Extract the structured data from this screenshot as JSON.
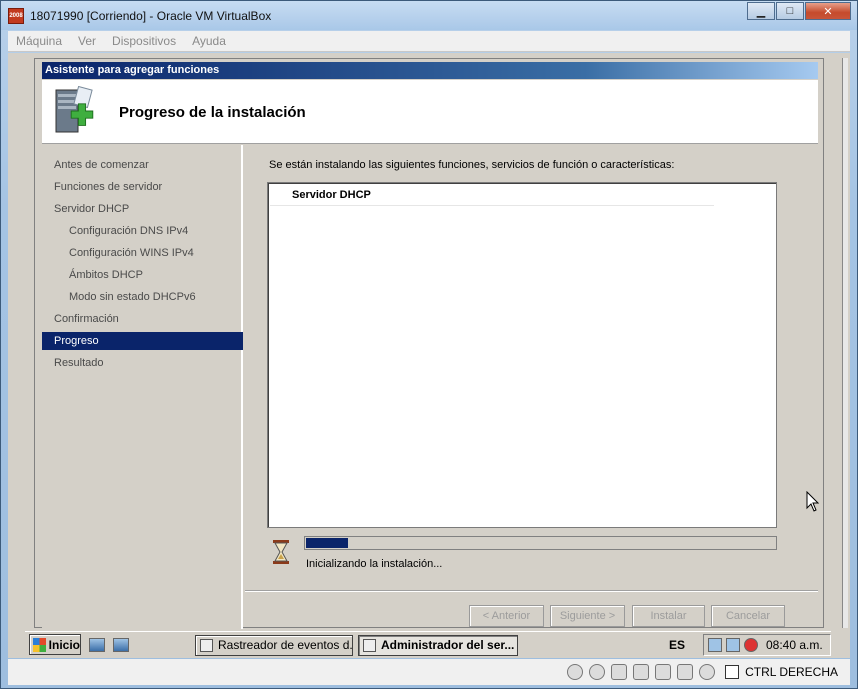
{
  "window": {
    "title": "18071990 [Corriendo] - Oracle VM VirtualBox",
    "app_icon_text": "2008",
    "minimize_glyph": "▁",
    "maximize_glyph": "□",
    "close_glyph": "✕"
  },
  "menubar": {
    "items": [
      "Máquina",
      "Ver",
      "Dispositivos",
      "Ayuda"
    ]
  },
  "wizard": {
    "title": "Asistente para agregar funciones",
    "header_title": "Progreso de la instalación",
    "nav": [
      {
        "label": "Antes de comenzar",
        "level": "top"
      },
      {
        "label": "Funciones de servidor",
        "level": "top"
      },
      {
        "label": "Servidor DHCP",
        "level": "top"
      },
      {
        "label": "Configuración DNS IPv4",
        "level": "sub"
      },
      {
        "label": "Configuración WINS IPv4",
        "level": "sub"
      },
      {
        "label": "Ámbitos DHCP",
        "level": "sub"
      },
      {
        "label": "Modo sin estado DHCPv6",
        "level": "sub"
      },
      {
        "label": "Confirmación",
        "level": "top"
      },
      {
        "label": "Progreso",
        "level": "top",
        "active": true
      },
      {
        "label": "Resultado",
        "level": "top"
      }
    ],
    "intro": "Se están instalando las siguientes funciones, servicios de función o características:",
    "installing_items": [
      "Servidor DHCP"
    ],
    "progress_fraction": 0.09,
    "status": "Inicializando la instalación...",
    "buttons": {
      "prev": "< Anterior",
      "next": "Siguiente >",
      "install": "Instalar",
      "cancel": "Cancelar"
    }
  },
  "taskbar": {
    "start": "Inicio",
    "tasks": [
      {
        "label": "Rastreador de eventos d...",
        "active": false
      },
      {
        "label": "Administrador del ser...",
        "active": true
      }
    ],
    "language": "ES",
    "clock": "08:40 a.m."
  },
  "statusbar": {
    "host_key": "CTRL DERECHA"
  },
  "colors": {
    "selection": "#0a246a",
    "progress": "#0a246a",
    "guest_background": "#d4d0c8"
  }
}
